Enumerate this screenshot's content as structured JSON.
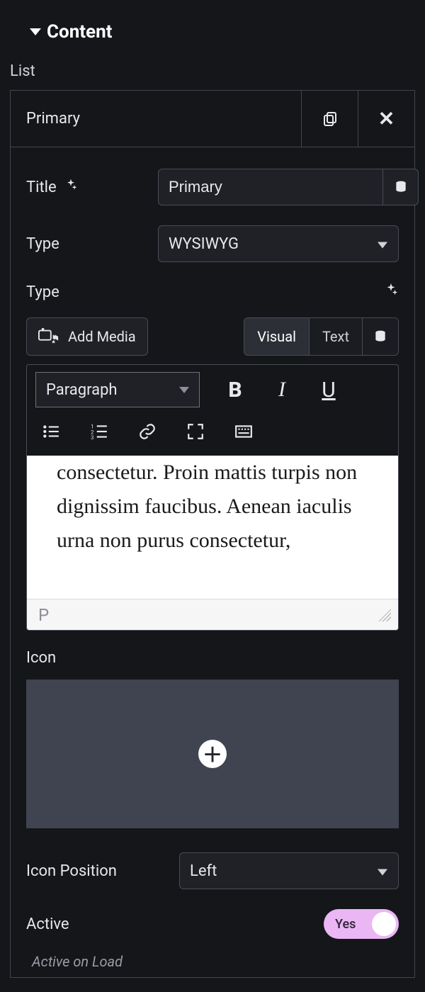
{
  "section": {
    "title": "Content"
  },
  "list": {
    "label": "List",
    "items": [
      {
        "name": "Primary",
        "fields": {
          "title": {
            "label": "Title",
            "value": "Primary"
          },
          "type_select": {
            "label": "Type",
            "value": "WYSIWYG"
          },
          "editor_label": "Type",
          "add_media_label": "Add Media",
          "tabs": {
            "visual": "Visual",
            "text": "Text"
          },
          "paragraph_select": "Paragraph",
          "content_text": "consectetur. Proin mattis turpis non dignissim faucibus. Aenean iaculis urna non purus consectetur,",
          "status_tag": "P",
          "icon_label": "Icon",
          "icon_position": {
            "label": "Icon Position",
            "value": "Left"
          },
          "active": {
            "label": "Active",
            "value": "Yes"
          },
          "active_hint": "Active on Load"
        }
      }
    ]
  }
}
